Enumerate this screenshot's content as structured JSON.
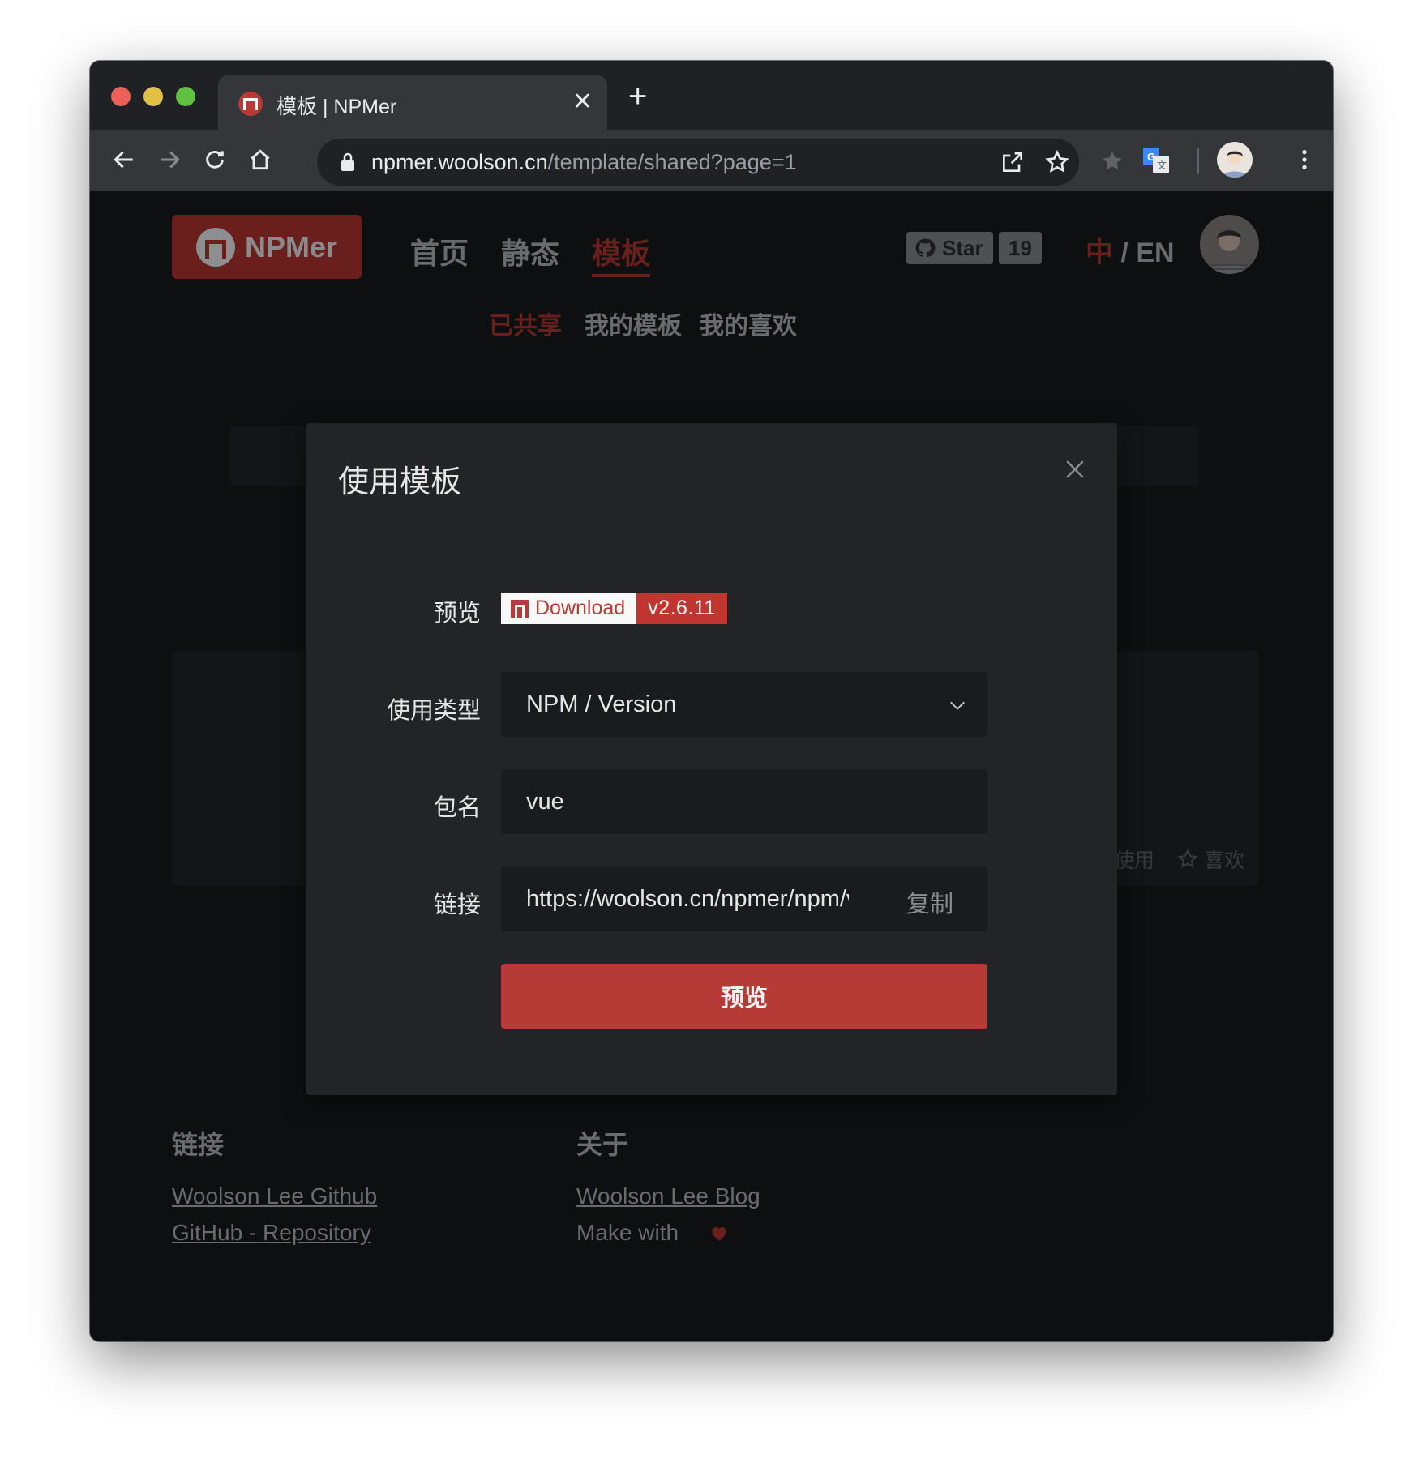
{
  "browser": {
    "tab_title": "模板 | NPMer",
    "tab_close": "✕",
    "new_tab": "+",
    "url_host": "npmer.woolson.cn",
    "url_path": "/template/shared?page=1"
  },
  "header": {
    "logo_text": "NPMer",
    "nav": [
      "首页",
      "静态",
      "模板"
    ],
    "active_nav": "模板",
    "github_star_label": "Star",
    "github_star_count": "19",
    "lang_zh": "中",
    "lang_sep": " / ",
    "lang_en": "EN"
  },
  "subnav": [
    "已共享",
    "我的模板",
    "我的喜欢"
  ],
  "background_card": {
    "use_label": "使用",
    "like_label": "喜欢"
  },
  "modal": {
    "title": "使用模板",
    "preview_label": "预览",
    "badge_text": "Download",
    "badge_version": "v2.6.11",
    "type_label": "使用类型",
    "type_value": "NPM / Version",
    "package_label": "包名",
    "package_value": "vue",
    "link_label": "链接",
    "link_value": "https://woolson.cn/npmer/npm/v",
    "copy_label": "复制",
    "submit_label": "预览"
  },
  "footer": {
    "links_heading": "链接",
    "links": [
      "Woolson Lee Github",
      "GitHub - Repository"
    ],
    "about_heading": "关于",
    "about_link": "Woolson Lee Blog",
    "made_with": "Make with"
  },
  "colors": {
    "accent": "#b63a35",
    "accent_dim": "#6b1f1d",
    "page_bg": "#0e0f11",
    "modal_bg": "#222428",
    "input_bg": "#1a1b1e"
  }
}
